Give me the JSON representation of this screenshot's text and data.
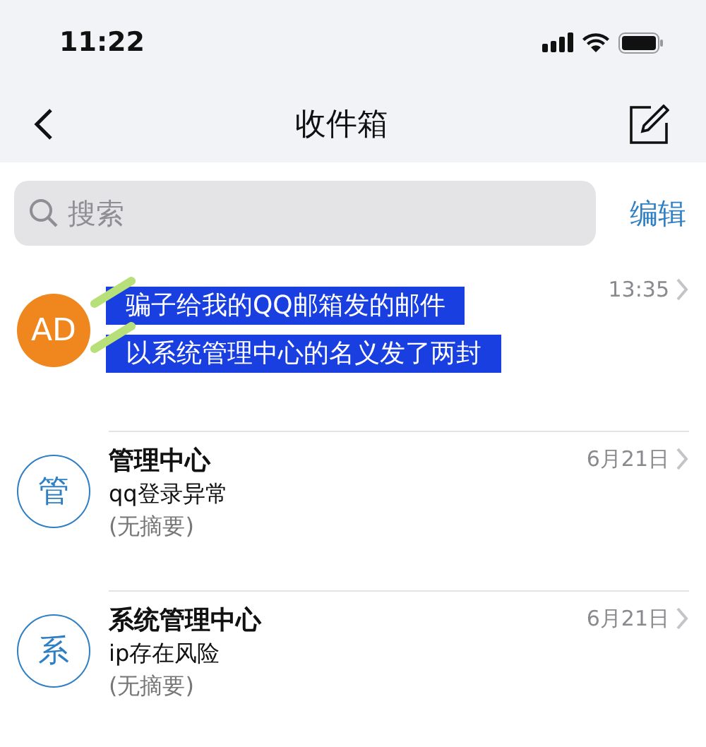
{
  "status_bar": {
    "time": "11:22"
  },
  "nav": {
    "title": "收件箱"
  },
  "search": {
    "placeholder": "搜索",
    "edit": "编辑"
  },
  "emails": [
    {
      "avatar": "AD",
      "kind": "filled",
      "color": "#f0861e",
      "time": "13:35"
    },
    {
      "avatar": "管",
      "kind": "outline",
      "color": "#2f7fc4",
      "sender": "管理中心",
      "subject": "qq登录异常",
      "preview": "(无摘要)",
      "time": "6月21日"
    },
    {
      "avatar": "系",
      "kind": "outline",
      "color": "#2f7fc4",
      "sender": "系统管理中心",
      "subject": "ip存在风险",
      "preview": "(无摘要)",
      "time": "6月21日"
    }
  ],
  "annotation": [
    "骗子给我的QQ邮箱发的邮件",
    "以系统管理中心的名义发了两封"
  ]
}
